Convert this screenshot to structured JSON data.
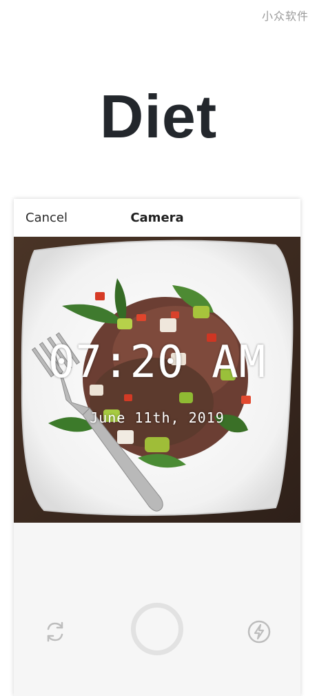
{
  "watermark": "小众软件",
  "hero": {
    "title": "Diet"
  },
  "navbar": {
    "cancel_label": "Cancel",
    "title": "Camera"
  },
  "overlay": {
    "time": "07:20 AM",
    "date": "June 11th, 2019"
  },
  "icons": {
    "switch": "switch-camera-icon",
    "shutter": "shutter-button",
    "flash": "flash-icon"
  },
  "colors": {
    "title": "#23272c",
    "icon": "#bdbdbd",
    "background": "#f6f6f6"
  }
}
